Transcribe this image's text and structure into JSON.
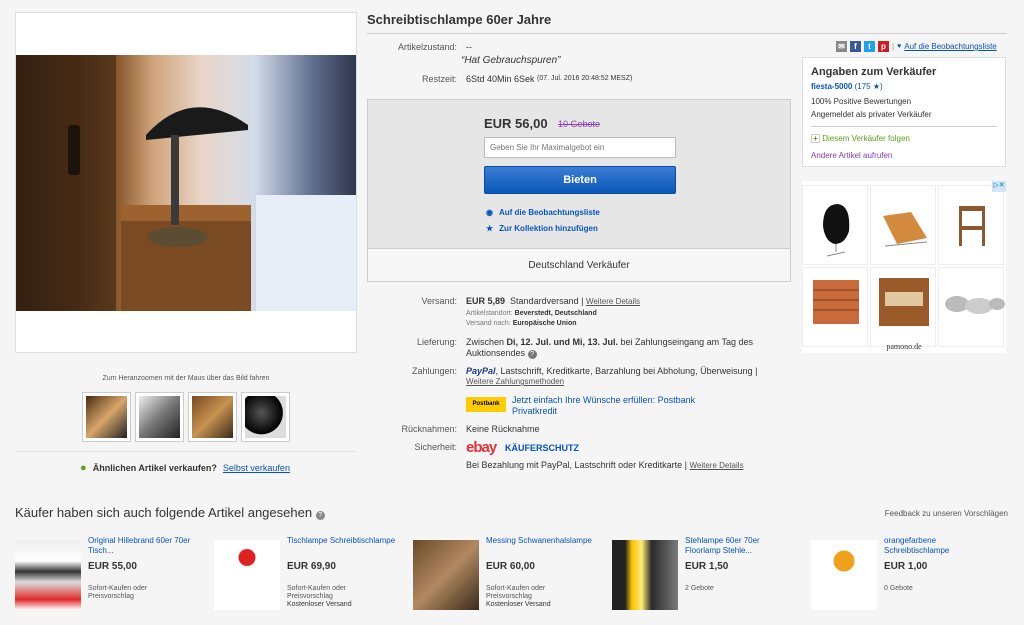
{
  "listing": {
    "title": "Schreibtischlampe 60er Jahre",
    "condition_label": "Artikelzustand:",
    "condition_value": "--",
    "condition_quote": "“Hat Gebrauchspuren”",
    "time_label": "Restzeit:",
    "time_value": "6Std 40Min 6Sek",
    "time_end": "(07. Jul. 2016   20:48:52 MESZ)"
  },
  "gallery": {
    "zoom_hint": "Zum Heranzoomen mit der Maus über das Bild fahren",
    "sell_question": "Ähnlichen Artikel verkaufen?",
    "sell_link": "Selbst verkaufen"
  },
  "bid": {
    "price": "EUR 56,00",
    "bids": "10 Gebote",
    "input_placeholder": "Geben Sie Ihr Maximalgebot ein",
    "button": "Bieten",
    "watch": "Auf die Beobachtungsliste",
    "collection": "Zur Kollektion hinzufügen",
    "footer": "Deutschland Verkäufer"
  },
  "details": {
    "shipping_label": "Versand:",
    "shipping_price": "EUR 5,89",
    "shipping_type": "Standardversand",
    "shipping_more": "Weitere Details",
    "location_label": "Artikelstandort:",
    "location_value": "Beverstedt, Deutschland",
    "shipto_label": "Versand nach:",
    "shipto_value": "Europäische Union",
    "delivery_label": "Lieferung:",
    "delivery_pre": "Zwischen ",
    "delivery_dates": "Di, 12. Jul. und Mi, 13. Jul.",
    "delivery_post": " bei Zahlungseingang am Tag des Auktionsendes",
    "payment_label": "Zahlungen:",
    "paypal": "PayPal",
    "payment_methods": ", Lastschrift, Kreditkarte, Barzahlung bei Abholung, Überweisung |",
    "payment_more": "Weitere Zahlungsmethoden",
    "postbank_logo": "Postbank",
    "postbank_text": "Jetzt einfach Ihre Wünsche erfüllen: Postbank Privatkredit",
    "returns_label": "Rücknahmen:",
    "returns_value": "Keine Rücknahme",
    "security_label": "Sicherheit:",
    "ebay_logo": "ebay",
    "buyer_protection": "KÄUFERSCHUTZ",
    "security_text": "Bei Bezahlung mit PayPal, Lastschrift oder Kreditkarte |",
    "security_more": "Weitere Details"
  },
  "watchlist_link": "Auf die Beobachtungsliste",
  "seller": {
    "heading": "Angaben zum Verkäufer",
    "name": "fiesta-5000",
    "score": "(175 ★)",
    "positive": "100% Positive Bewertungen",
    "private": "Angemeldet als privater Verkäufer",
    "follow": "Diesem Verkäufer folgen",
    "other_items": "Andere Artikel aufrufen"
  },
  "ad": {
    "footer": "pamono.de",
    "badge": "▷✕"
  },
  "also_viewed": {
    "title": "Käufer haben sich auch folgende Artikel angesehen",
    "feedback": "Feedback zu unseren Vorschlägen",
    "items": [
      {
        "name": "Original Hillebrand 60er 70er Tisch...",
        "price": "EUR 55,00",
        "sub1": "Sofort-Kaufen oder Preisvorschlag",
        "sub2": ""
      },
      {
        "name": "Tischlampe Schreibtischlampe",
        "price": "EUR 69,90",
        "sub1": "Sofort-Kaufen oder Preisvorschlag",
        "sub2": "Kostenloser Versand"
      },
      {
        "name": "Messing Schwanenhalslampe",
        "price": "EUR 60,00",
        "sub1": "Sofort-Kaufen oder Preisvorschlag",
        "sub2": "Kostenloser Versand"
      },
      {
        "name": "Stehlampe 60er 70er Floorlamp Stehle...",
        "price": "EUR 1,50",
        "sub1": "2 Gebote",
        "sub2": ""
      },
      {
        "name": "orangefarbene Schreibtischlampe",
        "price": "EUR 1,00",
        "sub1": "0 Gebote",
        "sub2": ""
      }
    ]
  }
}
